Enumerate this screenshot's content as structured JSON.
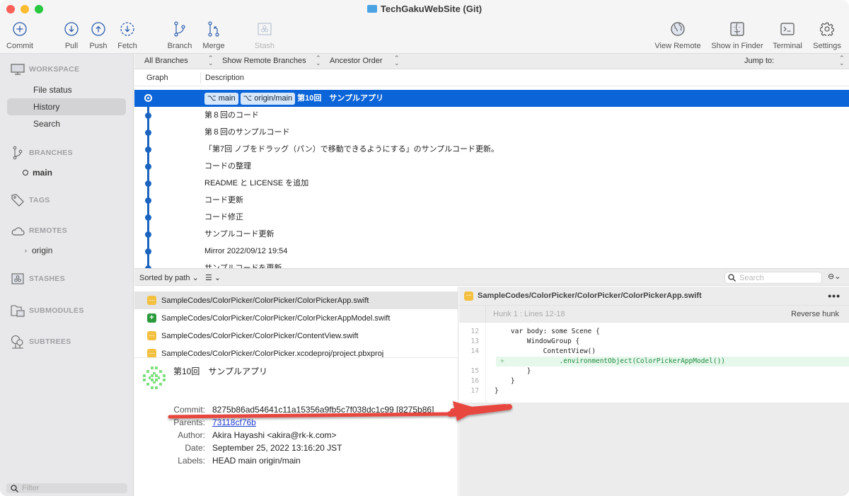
{
  "window": {
    "title": "TechGakuWebSite (Git)"
  },
  "toolbar": {
    "commit": "Commit",
    "pull": "Pull",
    "push": "Push",
    "fetch": "Fetch",
    "branch": "Branch",
    "merge": "Merge",
    "stash": "Stash",
    "view_remote": "View Remote",
    "show_in_finder": "Show in Finder",
    "terminal": "Terminal",
    "settings": "Settings"
  },
  "sidebar": {
    "workspace": "WORKSPACE",
    "workspace_items": [
      "File status",
      "History",
      "Search"
    ],
    "selected": "History",
    "branches": "BRANCHES",
    "branch_items": [
      "main"
    ],
    "tags": "TAGS",
    "remotes": "REMOTES",
    "remote_items": [
      "origin"
    ],
    "stashes": "STASHES",
    "submodules": "SUBMODULES",
    "subtrees": "SUBTREES",
    "filter_placeholder": "Filter"
  },
  "filterbar": {
    "branches": "All Branches",
    "remote": "Show Remote Branches",
    "order": "Ancestor Order",
    "jump_to": "Jump to:"
  },
  "history": {
    "columns": [
      "Graph",
      "Description"
    ],
    "commits": [
      {
        "badges": [
          "main",
          "origin/main"
        ],
        "description": "第10回　サンプルアプリ",
        "selected": true
      },
      {
        "badges": [],
        "description": "第８回のコード"
      },
      {
        "badges": [],
        "description": "第８回のサンプルコード"
      },
      {
        "badges": [],
        "description": "「第7回 ノブをドラッグ（パン）で移動できるようにする」のサンプルコード更新。"
      },
      {
        "badges": [],
        "description": "コードの整理"
      },
      {
        "badges": [],
        "description": "README と LICENSE を追加"
      },
      {
        "badges": [],
        "description": "コード更新"
      },
      {
        "badges": [],
        "description": "コード修正"
      },
      {
        "badges": [],
        "description": "サンプルコード更新"
      },
      {
        "badges": [],
        "description": "Mirror 2022/09/12 19:54"
      },
      {
        "badges": [],
        "description": "サンプルコードを更新"
      }
    ]
  },
  "files_bar": {
    "sort": "Sorted by path",
    "search_placeholder": "Search"
  },
  "files": [
    {
      "status": "modified",
      "path": "SampleCodes/ColorPicker/ColorPicker/ColorPickerApp.swift",
      "selected": true
    },
    {
      "status": "added",
      "path": "SampleCodes/ColorPicker/ColorPicker/ColorPickerAppModel.swift"
    },
    {
      "status": "modified",
      "path": "SampleCodes/ColorPicker/ColorPicker/ContentView.swift"
    },
    {
      "status": "modified",
      "path": "SampleCodes/ColorPicker/ColorPicker.xcodeproj/project.pbxproj"
    }
  ],
  "commit_details": {
    "title": "第10回　サンプルアプリ",
    "commit_label": "Commit:",
    "commit": "8275b86ad54641c11a15356a9fb5c7f038dc1c99 [8275b86]",
    "parents_label": "Parents:",
    "parents": "73118cf76b",
    "author_label": "Author:",
    "author": "Akira Hayashi <akira@rk-k.com>",
    "date_label": "Date:",
    "date": "September 25, 2022 13:16:20 JST",
    "labels_label": "Labels:",
    "labels": "HEAD main origin/main"
  },
  "diff": {
    "file": "SampleCodes/ColorPicker/ColorPicker/ColorPickerApp.swift",
    "hunk": "Hunk 1 : Lines 12-18",
    "reverse_hunk": "Reverse hunk",
    "lines": [
      {
        "num": "12",
        "type": "context",
        "text": "    var body: some Scene {"
      },
      {
        "num": "13",
        "type": "context",
        "text": "        WindowGroup {"
      },
      {
        "num": "14",
        "type": "context",
        "text": "            ContentView()"
      },
      {
        "num": "",
        "type": "added",
        "marker": "+",
        "text": "                .environmentObject(ColorPickerAppModel())"
      },
      {
        "num": "15",
        "type": "context",
        "text": "        }"
      },
      {
        "num": "16",
        "type": "context",
        "text": "    }"
      },
      {
        "num": "17",
        "type": "context",
        "text": "}"
      }
    ]
  },
  "colors": {
    "selection": "#0b64d8",
    "graph": "#1a64c0",
    "annotation_arrow": "#e8473f"
  }
}
